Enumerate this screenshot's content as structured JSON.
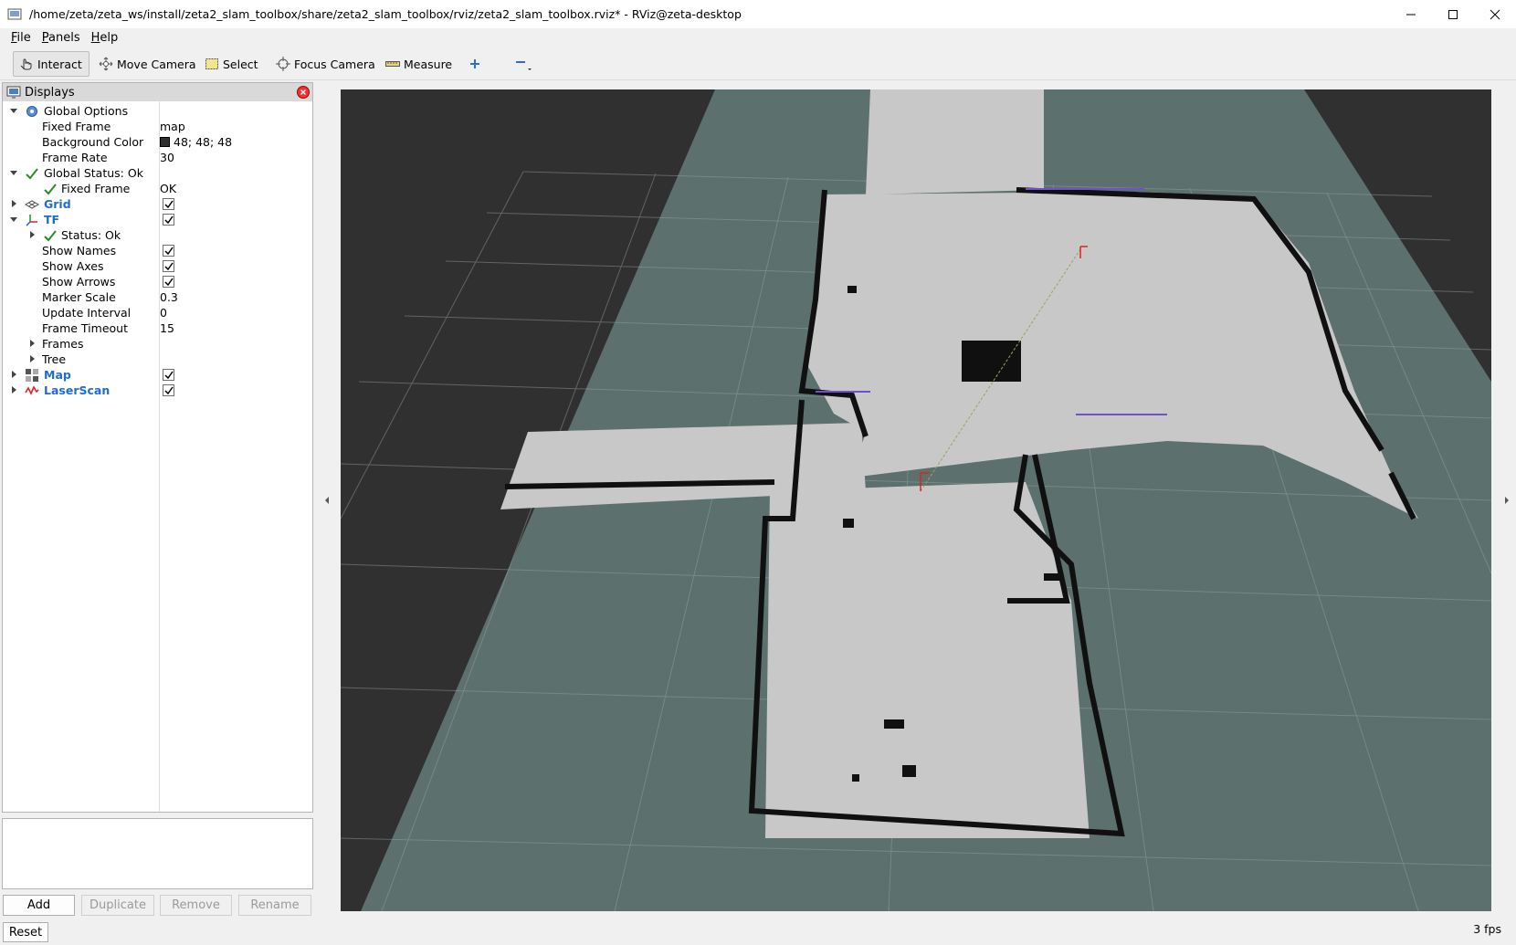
{
  "window": {
    "title": "/home/zeta/zeta_ws/install/zeta2_slam_toolbox/share/zeta2_slam_toolbox/rviz/zeta2_slam_toolbox.rviz* - RViz@zeta-desktop"
  },
  "menu": {
    "items": [
      {
        "first": "F",
        "rest": "ile"
      },
      {
        "first": "P",
        "rest": "anels"
      },
      {
        "first": "H",
        "rest": "elp"
      }
    ]
  },
  "toolbar": {
    "interact": "Interact",
    "move_camera": "Move Camera",
    "select": "Select",
    "focus_camera": "Focus Camera",
    "measure": "Measure"
  },
  "displays": {
    "title": "Displays",
    "rows": {
      "global_options": "Global Options",
      "fixed_frame": {
        "name": "Fixed Frame",
        "value": "map"
      },
      "background_color": {
        "name": "Background Color",
        "value": "48; 48; 48"
      },
      "frame_rate": {
        "name": "Frame Rate",
        "value": "30"
      },
      "global_status": "Global Status: Ok",
      "status_fixed_frame": {
        "name": "Fixed Frame",
        "value": "OK"
      },
      "grid": "Grid",
      "tf": "TF",
      "tf_status": "Status: Ok",
      "show_names": "Show Names",
      "show_axes": "Show Axes",
      "show_arrows": "Show Arrows",
      "marker_scale": {
        "name": "Marker Scale",
        "value": "0.3"
      },
      "update_interval": {
        "name": "Update Interval",
        "value": "0"
      },
      "frame_timeout": {
        "name": "Frame Timeout",
        "value": "15"
      },
      "frames": "Frames",
      "tree": "Tree",
      "map": "Map",
      "laserscan": "LaserScan"
    }
  },
  "buttons": {
    "add": "Add",
    "duplicate": "Duplicate",
    "remove": "Remove",
    "rename": "Rename",
    "reset": "Reset"
  },
  "status": {
    "fps": "3 fps"
  },
  "colors": {
    "background": "#303030",
    "map_unknown": "#5c706e",
    "map_free": "#c8c8c8",
    "map_occupied": "#101010",
    "accent_blue": "#1f6bd6"
  }
}
